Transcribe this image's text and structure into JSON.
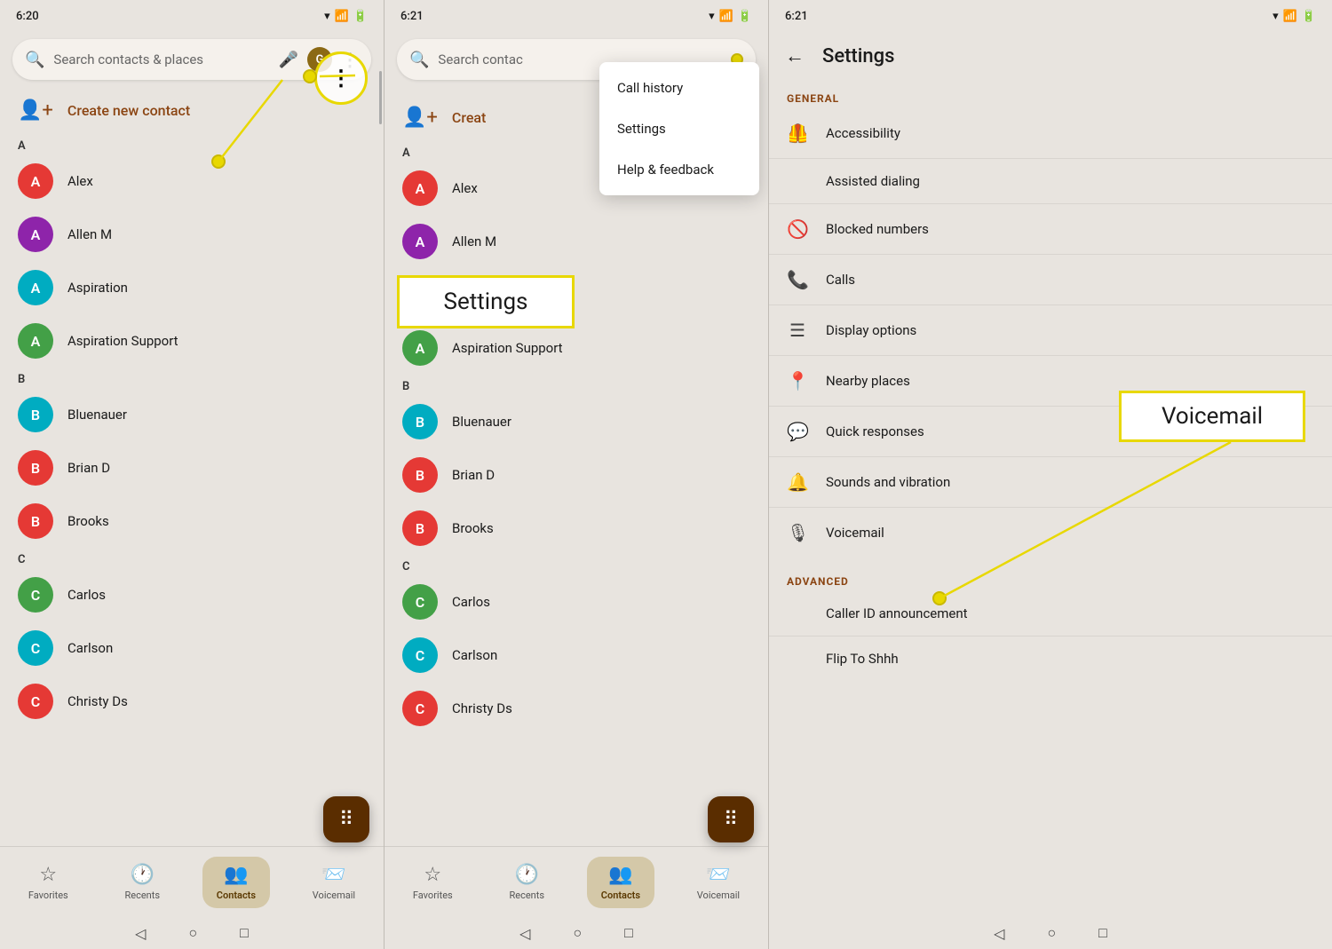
{
  "panels": [
    {
      "id": "panel1",
      "status_time": "6:20",
      "search_placeholder": "Search contacts & places",
      "contacts_label": "Create new contact",
      "sections": [
        {
          "letter": "A",
          "contacts": [
            {
              "name": "Alex",
              "color": "#e53935",
              "letter": "A"
            },
            {
              "name": "Allen M",
              "color": "#8e24aa",
              "letter": "A"
            },
            {
              "name": "Aspiration",
              "color": "#00acc1",
              "letter": "A"
            },
            {
              "name": "Aspiration Support",
              "color": "#43a047",
              "letter": "A"
            }
          ]
        },
        {
          "letter": "B",
          "contacts": [
            {
              "name": "Bluenauer",
              "color": "#00acc1",
              "letter": "B"
            },
            {
              "name": "Brian D",
              "color": "#e53935",
              "letter": "B"
            },
            {
              "name": "Brooks",
              "color": "#e53935",
              "letter": "B"
            }
          ]
        },
        {
          "letter": "C",
          "contacts": [
            {
              "name": "Carlos",
              "color": "#43a047",
              "letter": "C"
            },
            {
              "name": "Carlson",
              "color": "#00acc1",
              "letter": "C"
            },
            {
              "name": "Christy Ds",
              "color": "#e53935",
              "letter": "C"
            }
          ]
        }
      ],
      "nav": {
        "items": [
          {
            "label": "Favorites",
            "icon": "☆",
            "active": false
          },
          {
            "label": "Recents",
            "icon": "🕐",
            "active": false
          },
          {
            "label": "Contacts",
            "icon": "👤",
            "active": true
          },
          {
            "label": "Voicemail",
            "icon": "🎙",
            "active": false
          }
        ]
      },
      "annotation": {
        "more_circle": true,
        "create_contact_arrow": true
      }
    },
    {
      "id": "panel2",
      "status_time": "6:21",
      "search_placeholder": "Search contac",
      "dropdown": {
        "items": [
          "Call history",
          "Settings",
          "Help & feedback"
        ]
      },
      "settings_box": "Settings",
      "contacts_label": "Creat",
      "sections": [
        {
          "letter": "A",
          "contacts": [
            {
              "name": "Alex",
              "color": "#e53935",
              "letter": "A"
            },
            {
              "name": "Allen M",
              "color": "#8e24aa",
              "letter": "A"
            },
            {
              "name": "Aspiration",
              "color": "#00acc1",
              "letter": "A"
            },
            {
              "name": "Aspiration Support",
              "color": "#43a047",
              "letter": "A"
            }
          ]
        },
        {
          "letter": "B",
          "contacts": [
            {
              "name": "Bluenauer",
              "color": "#00acc1",
              "letter": "B"
            },
            {
              "name": "Brian D",
              "color": "#e53935",
              "letter": "B"
            },
            {
              "name": "Brooks",
              "color": "#e53935",
              "letter": "B"
            }
          ]
        },
        {
          "letter": "C",
          "contacts": [
            {
              "name": "Carlos",
              "color": "#43a047",
              "letter": "C"
            },
            {
              "name": "Carlson",
              "color": "#00acc1",
              "letter": "C"
            },
            {
              "name": "Christy Ds",
              "color": "#e53935",
              "letter": "C"
            }
          ]
        }
      ],
      "nav": {
        "items": [
          {
            "label": "Favorites",
            "icon": "☆",
            "active": false
          },
          {
            "label": "Recents",
            "icon": "🕐",
            "active": false
          },
          {
            "label": "Contacts",
            "icon": "👤",
            "active": true
          },
          {
            "label": "Voicemail",
            "icon": "🎙",
            "active": false
          }
        ]
      }
    },
    {
      "id": "panel3",
      "status_time": "6:21",
      "title": "Settings",
      "sections": [
        {
          "label": "GENERAL",
          "items": [
            {
              "icon": "accessibility",
              "label": "Accessibility"
            },
            {
              "icon": "assisted_dialing",
              "label": "Assisted dialing"
            },
            {
              "icon": "blocked",
              "label": "Blocked numbers"
            },
            {
              "icon": "calls",
              "label": "Calls"
            },
            {
              "icon": "display",
              "label": "Display options"
            },
            {
              "icon": "nearby",
              "label": "Nearby places"
            },
            {
              "icon": "quick_responses",
              "label": "Quick responses"
            },
            {
              "icon": "sounds",
              "label": "Sounds and vibration"
            },
            {
              "icon": "voicemail",
              "label": "Voicemail"
            }
          ]
        },
        {
          "label": "ADVANCED",
          "items": [
            {
              "icon": "caller_id",
              "label": "Caller ID announcement"
            },
            {
              "icon": "flip",
              "label": "Flip To Shhh"
            }
          ]
        }
      ],
      "voicemail_box": "Voicemail"
    }
  ]
}
